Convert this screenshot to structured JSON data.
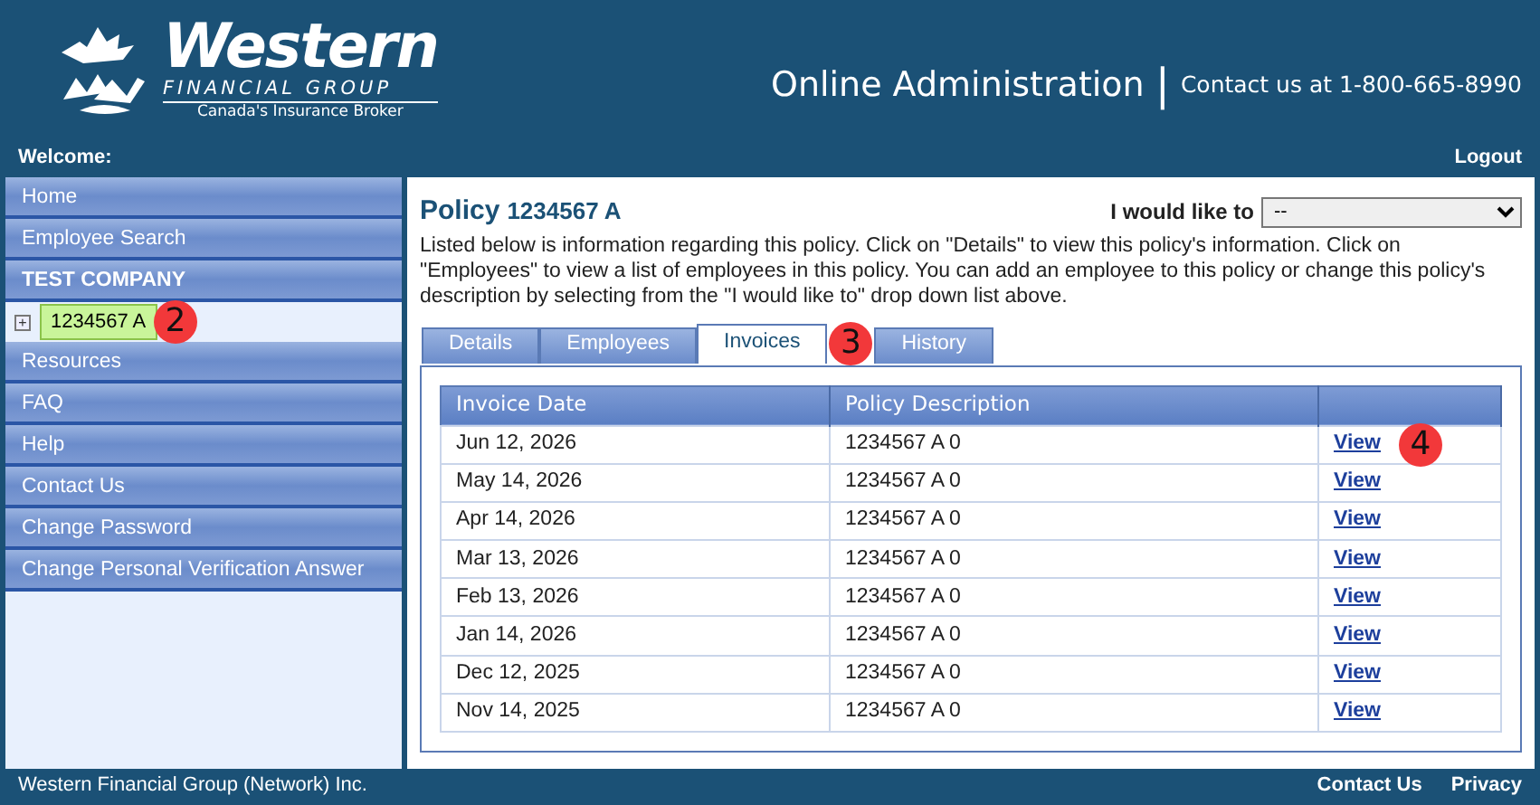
{
  "header": {
    "logo": {
      "name": "Western",
      "subtitle": "FINANCIAL GROUP",
      "tagline": "Canada's Insurance Broker"
    },
    "title": "Online Administration",
    "separator": "|",
    "contact": "Contact us at 1-800-665-8990"
  },
  "welcome_bar": {
    "welcome": "Welcome:",
    "logout": "Logout"
  },
  "sidebar": {
    "items": [
      {
        "kind": "link",
        "label": "Home"
      },
      {
        "kind": "link",
        "label": "Employee Search"
      },
      {
        "kind": "heading",
        "label": "TEST COMPANY"
      },
      {
        "kind": "policy",
        "label": "1234567 A",
        "selected": true,
        "expander": "+",
        "callout": "2"
      },
      {
        "kind": "link",
        "label": "Resources"
      },
      {
        "kind": "link",
        "label": "FAQ"
      },
      {
        "kind": "link",
        "label": "Help"
      },
      {
        "kind": "link",
        "label": "Contact Us"
      },
      {
        "kind": "link",
        "label": "Change Password"
      },
      {
        "kind": "link",
        "label": "Change Personal Verification Answer"
      }
    ]
  },
  "policy": {
    "title": "Policy",
    "number": "1234567 A",
    "action_label": "I would like to",
    "action_value": "--",
    "description": "Listed below is information regarding this policy. Click on \"Details\" to view this policy's information. Click on \"Employees\" to view a list of employees in this policy. You can add an employee to this policy or change this policy's description by selecting from the \"I would like to\" drop down list above."
  },
  "tabs": [
    {
      "label": "Details",
      "selected": false
    },
    {
      "label": "Employees",
      "selected": false
    },
    {
      "label": "Invoices",
      "selected": true,
      "callout": "3"
    },
    {
      "label": "History",
      "selected": false
    }
  ],
  "table": {
    "columns": [
      "Invoice Date",
      "Policy Description"
    ],
    "rows": [
      {
        "date": "Jun 12, 2026",
        "description": "1234567 A 0",
        "action": "View",
        "callout": "4"
      },
      {
        "date": "May 14, 2026",
        "description": "1234567 A 0",
        "action": "View"
      },
      {
        "date": "Apr 14, 2026",
        "description": "1234567 A 0",
        "action": "View"
      },
      {
        "date": "Mar 13, 2026",
        "description": "1234567 A 0",
        "action": "View"
      },
      {
        "date": "Feb 13, 2026",
        "description": "1234567 A 0",
        "action": "View"
      },
      {
        "date": "Jan 14, 2026",
        "description": "1234567 A 0",
        "action": "View"
      },
      {
        "date": "Dec 12, 2025",
        "description": "1234567 A 0",
        "action": "View"
      },
      {
        "date": "Nov 14, 2025",
        "description": "1234567 A 0",
        "action": "View"
      }
    ]
  },
  "footer": {
    "company": "Western Financial Group (Network) Inc.",
    "links": [
      "Contact Us",
      "Privacy"
    ]
  }
}
